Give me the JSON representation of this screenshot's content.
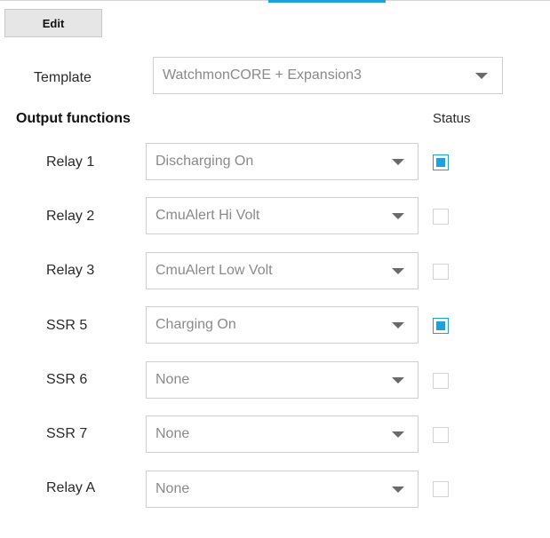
{
  "toolbar": {
    "edit_label": "Edit"
  },
  "colors": {
    "accent": "#1ea0dc"
  },
  "template": {
    "label": "Template",
    "value": "WatchmonCORE + Expansion3"
  },
  "output_functions": {
    "title": "Output functions",
    "status_header": "Status",
    "rows": [
      {
        "label": "Relay 1",
        "value": "Discharging On",
        "status": true
      },
      {
        "label": "Relay 2",
        "value": "CmuAlert Hi Volt",
        "status": false
      },
      {
        "label": "Relay 3",
        "value": "CmuAlert Low Volt",
        "status": false
      },
      {
        "label": "SSR 5",
        "value": "Charging On",
        "status": true
      },
      {
        "label": "SSR 6",
        "value": "None",
        "status": false
      },
      {
        "label": "SSR 7",
        "value": "None",
        "status": false
      },
      {
        "label": "Relay A",
        "value": "None",
        "status": false
      }
    ]
  }
}
